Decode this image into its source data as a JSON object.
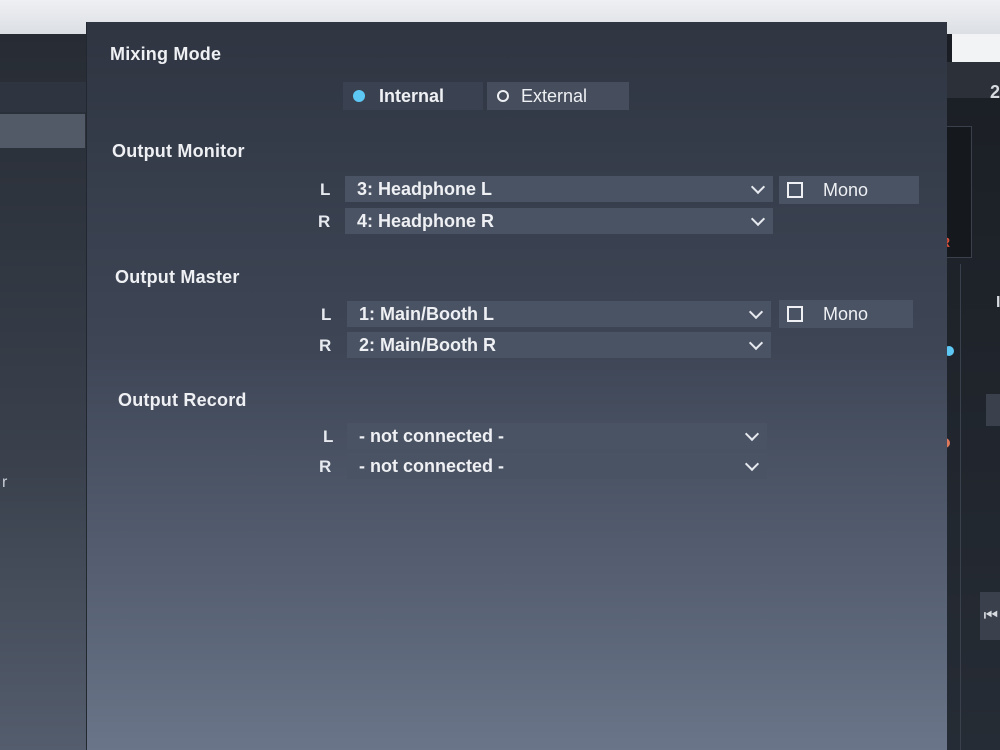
{
  "mixing_mode": {
    "title": "Mixing Mode",
    "options": [
      {
        "label": "Internal",
        "selected": true
      },
      {
        "label": "External",
        "selected": false
      }
    ]
  },
  "output_monitor": {
    "title": "Output Monitor",
    "left": {
      "channel": "L",
      "value": "3: Headphone L"
    },
    "right": {
      "channel": "R",
      "value": "4: Headphone R"
    },
    "mono_label": "Mono",
    "mono_checked": false
  },
  "output_master": {
    "title": "Output Master",
    "left": {
      "channel": "L",
      "value": "1: Main/Booth L"
    },
    "right": {
      "channel": "R",
      "value": "2: Main/Booth R"
    },
    "mono_label": "Mono",
    "mono_checked": false
  },
  "output_record": {
    "title": "Output Record",
    "left": {
      "channel": "L",
      "value": "- not connected -"
    },
    "right": {
      "channel": "R",
      "value": "- not connected -"
    }
  },
  "background": {
    "right_header_number": "2",
    "right_meter_label": "R",
    "right_side_label": "I",
    "skip_icon": "skip-back-icon",
    "left_glyph": "r"
  },
  "colors": {
    "accent_radio": "#5ec8f5",
    "indicator_blue": "#5ec8f5",
    "indicator_orange": "#e0785c"
  }
}
